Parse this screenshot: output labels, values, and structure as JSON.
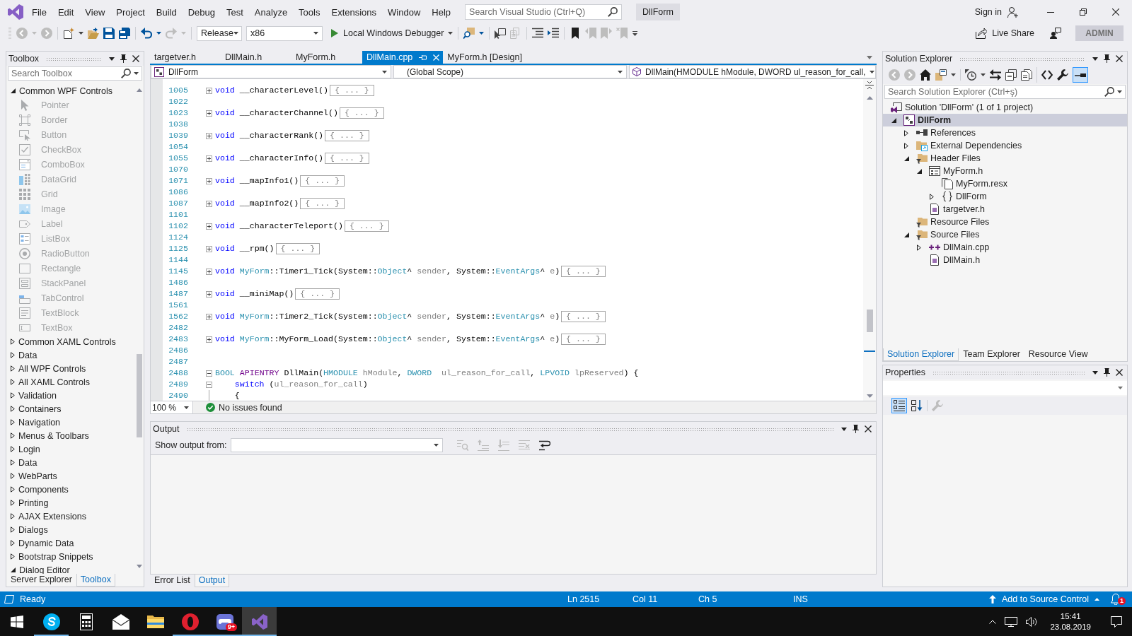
{
  "title_bar": {
    "menu": [
      "File",
      "Edit",
      "View",
      "Project",
      "Build",
      "Debug",
      "Test",
      "Analyze",
      "Tools",
      "Extensions",
      "Window",
      "Help"
    ],
    "search": {
      "placeholder": "Search Visual Studio (Ctrl+Q)"
    },
    "solution_name": "DllForm",
    "sign_in": "Sign in"
  },
  "toolbar": {
    "groups": [
      {
        "items": [
          {
            "kind": "back",
            "disabled": true,
            "dropdown": true
          },
          {
            "kind": "forward",
            "disabled": true,
            "dropdown": false
          }
        ]
      },
      {
        "items": [
          {
            "kind": "new",
            "disabled": false,
            "dropdown": true
          },
          {
            "kind": "open",
            "disabled": false,
            "dropdown": false
          },
          {
            "kind": "save",
            "disabled": false,
            "dropdown": false
          },
          {
            "kind": "saveall",
            "disabled": false,
            "dropdown": false
          }
        ]
      },
      {
        "items": [
          {
            "kind": "undo",
            "disabled": false,
            "dropdown": true
          },
          {
            "kind": "redo",
            "disabled": true,
            "dropdown": true
          }
        ]
      },
      {
        "items": [
          {
            "kind": "configuration",
            "value": "Release"
          },
          {
            "kind": "platform",
            "value": "x86"
          },
          {
            "kind": "run",
            "label": "Local Windows Debugger",
            "dropdown": true
          }
        ]
      },
      {
        "items": [
          {
            "kind": "find",
            "disabled": false,
            "dropdown": true
          }
        ]
      },
      {
        "items": [
          {
            "kind": "select",
            "disabled": false,
            "dropdown": false
          },
          {
            "kind": "pages",
            "disabled": true,
            "dropdown": false
          }
        ]
      },
      {
        "items": [
          {
            "kind": "lines",
            "disabled": false,
            "dropdown": false
          },
          {
            "kind": "listarrow",
            "disabled": false,
            "dropdown": false
          }
        ]
      },
      {
        "items": [
          {
            "kind": "bookmark",
            "disabled": false,
            "dropdown": false
          },
          {
            "kind": "prevbm",
            "disabled": true,
            "dropdown": false
          },
          {
            "kind": "nextbm",
            "disabled": true,
            "dropdown": false
          },
          {
            "kind": "clearbm",
            "disabled": true,
            "dropdown": false
          }
        ]
      }
    ],
    "live_share": "Live Share",
    "account": "ADMIN"
  },
  "toolbox": {
    "title": "Toolbox",
    "search": {
      "placeholder": "Search Toolbox"
    },
    "groups": [
      {
        "label": "Common WPF Controls",
        "expanded": true,
        "items": [
          {
            "label": "Pointer",
            "kind": "pointer",
            "disabled": true
          },
          {
            "label": "Border",
            "kind": "border",
            "disabled": true
          },
          {
            "label": "Button",
            "kind": "button",
            "disabled": true
          },
          {
            "label": "CheckBox",
            "kind": "checkbox",
            "disabled": true
          },
          {
            "label": "ComboBox",
            "kind": "combobox",
            "disabled": true
          },
          {
            "label": "DataGrid",
            "kind": "datagrid",
            "disabled": true
          },
          {
            "label": "Grid",
            "kind": "grid",
            "disabled": true
          },
          {
            "label": "Image",
            "kind": "image",
            "disabled": true
          },
          {
            "label": "Label",
            "kind": "label",
            "disabled": true
          },
          {
            "label": "ListBox",
            "kind": "listbox",
            "disabled": true
          },
          {
            "label": "RadioButton",
            "kind": "radiobutton",
            "disabled": true
          },
          {
            "label": "Rectangle",
            "kind": "rectangle",
            "disabled": true
          },
          {
            "label": "StackPanel",
            "kind": "stackpanel",
            "disabled": true
          },
          {
            "label": "TabControl",
            "kind": "tabcontrol",
            "disabled": true
          },
          {
            "label": "TextBlock",
            "kind": "textblock",
            "disabled": true
          },
          {
            "label": "TextBox",
            "kind": "textbox",
            "disabled": true
          }
        ]
      },
      {
        "label": "Common XAML Controls",
        "expanded": false
      },
      {
        "label": "Data",
        "expanded": false
      },
      {
        "label": "All WPF Controls",
        "expanded": false
      },
      {
        "label": "All XAML Controls",
        "expanded": false
      },
      {
        "label": "Validation",
        "expanded": false
      },
      {
        "label": "Containers",
        "expanded": false
      },
      {
        "label": "Navigation",
        "expanded": false
      },
      {
        "label": "Menus & Toolbars",
        "expanded": false
      },
      {
        "label": "Login",
        "expanded": false
      },
      {
        "label": "Data",
        "expanded": false
      },
      {
        "label": "WebParts",
        "expanded": false
      },
      {
        "label": "Components",
        "expanded": false
      },
      {
        "label": "Printing",
        "expanded": false
      },
      {
        "label": "AJAX Extensions",
        "expanded": false
      },
      {
        "label": "Dialogs",
        "expanded": false
      },
      {
        "label": "Dynamic Data",
        "expanded": false
      },
      {
        "label": "Bootstrap Snippets",
        "expanded": false
      },
      {
        "label": "Dialog Editor",
        "expanded": true
      }
    ],
    "tabs": [
      {
        "label": "Server Explorer",
        "selected": false
      },
      {
        "label": "Toolbox",
        "selected": true
      }
    ]
  },
  "editor": {
    "tabs": [
      {
        "label": "targetver.h",
        "selected": false
      },
      {
        "label": "DllMain.h",
        "selected": false
      },
      {
        "label": "MyForm.h",
        "selected": false
      },
      {
        "label": "DllMain.cpp",
        "selected": true
      },
      {
        "label": "MyForm.h [Design]",
        "selected": false
      }
    ],
    "navigation": {
      "project": "DllForm",
      "scope": "(Global Scope)",
      "member": "DllMain(HMODULE hModule, DWORD ul_reason_for_call,"
    },
    "lines": [
      {
        "number": "1005",
        "expanded": false,
        "tokens": [
          {
            "kind": "keyword",
            "text": "void"
          },
          {
            "kind": "plain",
            "text": " __characterLevel()"
          }
        ],
        "block": "{ ... }"
      },
      {
        "number": "1022"
      },
      {
        "number": "1023",
        "expanded": false,
        "tokens": [
          {
            "kind": "keyword",
            "text": "void"
          },
          {
            "kind": "plain",
            "text": " __characterChannel()"
          }
        ],
        "block": "{ ... }"
      },
      {
        "number": "1038"
      },
      {
        "number": "1039",
        "expanded": false,
        "tokens": [
          {
            "kind": "keyword",
            "text": "void"
          },
          {
            "kind": "plain",
            "text": " __characterRank()"
          }
        ],
        "block": "{ ... }"
      },
      {
        "number": "1054"
      },
      {
        "number": "1055",
        "expanded": false,
        "tokens": [
          {
            "kind": "keyword",
            "text": "void"
          },
          {
            "kind": "plain",
            "text": " __characterInfo()"
          }
        ],
        "block": "{ ... }"
      },
      {
        "number": "1070"
      },
      {
        "number": "1071",
        "expanded": false,
        "tokens": [
          {
            "kind": "keyword",
            "text": "void"
          },
          {
            "kind": "plain",
            "text": " __mapInfo1()"
          }
        ],
        "block": "{ ... }"
      },
      {
        "number": "1086"
      },
      {
        "number": "1087",
        "expanded": false,
        "tokens": [
          {
            "kind": "keyword",
            "text": "void"
          },
          {
            "kind": "plain",
            "text": " __mapInfo2()"
          }
        ],
        "block": "{ ... }"
      },
      {
        "number": "1101"
      },
      {
        "number": "1102",
        "expanded": false,
        "tokens": [
          {
            "kind": "keyword",
            "text": "void"
          },
          {
            "kind": "plain",
            "text": " __characterTeleport()"
          }
        ],
        "block": "{ ... }"
      },
      {
        "number": "1124"
      },
      {
        "number": "1125",
        "expanded": false,
        "tokens": [
          {
            "kind": "keyword",
            "text": "void"
          },
          {
            "kind": "plain",
            "text": " __rpm()"
          }
        ],
        "block": "{ ... }"
      },
      {
        "number": "1144"
      },
      {
        "number": "1145",
        "expanded": false,
        "tokens": [
          {
            "kind": "keyword",
            "text": "void"
          },
          {
            "kind": "type",
            "text": " MyForm"
          },
          {
            "kind": "plain",
            "text": "::Timer1_Tick(System::"
          },
          {
            "kind": "type",
            "text": "Object"
          },
          {
            "kind": "plain",
            "text": "^ "
          },
          {
            "kind": "param",
            "text": "sender"
          },
          {
            "kind": "plain",
            "text": ", System::"
          },
          {
            "kind": "type",
            "text": "EventArgs"
          },
          {
            "kind": "plain",
            "text": "^ "
          },
          {
            "kind": "param",
            "text": "e"
          },
          {
            "kind": "plain",
            "text": ")"
          }
        ],
        "block": "{ ... }"
      },
      {
        "number": "1486"
      },
      {
        "number": "1487",
        "expanded": false,
        "tokens": [
          {
            "kind": "keyword",
            "text": "void"
          },
          {
            "kind": "plain",
            "text": " __miniMap()"
          }
        ],
        "block": "{ ... }"
      },
      {
        "number": "1561"
      },
      {
        "number": "1562",
        "expanded": false,
        "tokens": [
          {
            "kind": "keyword",
            "text": "void"
          },
          {
            "kind": "type",
            "text": " MyForm"
          },
          {
            "kind": "plain",
            "text": "::Timer2_Tick(System::"
          },
          {
            "kind": "type",
            "text": "Object"
          },
          {
            "kind": "plain",
            "text": "^ "
          },
          {
            "kind": "param",
            "text": "sender"
          },
          {
            "kind": "plain",
            "text": ", System::"
          },
          {
            "kind": "type",
            "text": "EventArgs"
          },
          {
            "kind": "plain",
            "text": "^ "
          },
          {
            "kind": "param",
            "text": "e"
          },
          {
            "kind": "plain",
            "text": ")"
          }
        ],
        "block": "{ ... }"
      },
      {
        "number": "2482"
      },
      {
        "number": "2483",
        "expanded": false,
        "tokens": [
          {
            "kind": "keyword",
            "text": "void"
          },
          {
            "kind": "type",
            "text": " MyForm"
          },
          {
            "kind": "plain",
            "text": "::MyForm_Load(System::"
          },
          {
            "kind": "type",
            "text": "Object"
          },
          {
            "kind": "plain",
            "text": "^ "
          },
          {
            "kind": "param",
            "text": "sender"
          },
          {
            "kind": "plain",
            "text": ", System::"
          },
          {
            "kind": "type",
            "text": "EventArgs"
          },
          {
            "kind": "plain",
            "text": "^ "
          },
          {
            "kind": "param",
            "text": "e"
          },
          {
            "kind": "plain",
            "text": ")"
          }
        ],
        "block": "{ ... }"
      },
      {
        "number": "2486"
      },
      {
        "number": "2487"
      },
      {
        "number": "2488",
        "expanded": true,
        "tokens": [
          {
            "kind": "type",
            "text": "BOOL"
          },
          {
            "kind": "macro",
            "text": " APIENTRY"
          },
          {
            "kind": "plain",
            "text": " DllMain("
          },
          {
            "kind": "type",
            "text": "HMODULE"
          },
          {
            "kind": "param",
            "text": " hModule"
          },
          {
            "kind": "plain",
            "text": ", "
          },
          {
            "kind": "type",
            "text": "DWORD"
          },
          {
            "kind": "param",
            "text": "  ul_reason_for_call"
          },
          {
            "kind": "plain",
            "text": ", "
          },
          {
            "kind": "type",
            "text": "LPVOID"
          },
          {
            "kind": "param",
            "text": " lpReserved"
          },
          {
            "kind": "plain",
            "text": ") {"
          }
        ]
      },
      {
        "number": "2489",
        "expanded": true,
        "tokens": [
          {
            "kind": "keyword",
            "text": "    switch"
          },
          {
            "kind": "plain",
            "text": " ("
          },
          {
            "kind": "param",
            "text": "ul_reason_for_call"
          },
          {
            "kind": "plain",
            "text": ")"
          }
        ]
      },
      {
        "number": "2490",
        "guide": true,
        "tokens": [
          {
            "kind": "plain",
            "text": "    {"
          }
        ]
      }
    ],
    "zoom": "100 %",
    "issues": "No issues found"
  },
  "output": {
    "title": "Output",
    "source_label": "Show output from:",
    "toolbar": [
      {
        "kind": "findmsg",
        "disabled": true
      },
      {
        "kind": "prevmsg",
        "disabled": true
      },
      {
        "kind": "nextmsg",
        "disabled": true
      },
      {
        "kind": "clearall",
        "disabled": true
      },
      {
        "kind": "wordwrap",
        "disabled": false
      }
    ],
    "tabs": [
      {
        "label": "Error List",
        "selected": false
      },
      {
        "label": "Output",
        "selected": true
      }
    ]
  },
  "solution_explorer": {
    "title": "Solution Explorer",
    "toolbar": {
      "groups": [
        {
          "items": [
            {
              "kind": "back",
              "disabled": true,
              "selected": false
            },
            {
              "kind": "forward",
              "disabled": true,
              "selected": false
            },
            {
              "kind": "home",
              "disabled": false,
              "selected": false
            },
            {
              "kind": "switchviews",
              "disabled": false,
              "selected": false,
              "dropdown": true
            }
          ]
        },
        {
          "items": [
            {
              "kind": "history",
              "disabled": false,
              "selected": false,
              "dropdown": true
            },
            {
              "kind": "sync",
              "disabled": false,
              "selected": false
            },
            {
              "kind": "collapse",
              "disabled": false,
              "selected": false
            },
            {
              "kind": "showall",
              "disabled": false,
              "selected": false
            }
          ]
        },
        {
          "items": [
            {
              "kind": "code",
              "disabled": false,
              "selected": false
            },
            {
              "kind": "wrench",
              "disabled": false,
              "selected": false
            },
            {
              "kind": "preview",
              "disabled": false,
              "selected": true
            }
          ]
        }
      ]
    },
    "search": {
      "placeholder": "Search Solution Explorer (Ctrl+ş)"
    },
    "tree": [
      {
        "label": "Solution 'DllForm' (1 of 1 project)",
        "kind": "solution",
        "selected": false,
        "children": [
          {
            "label": "DllForm",
            "kind": "project",
            "selected": true,
            "expanded": true,
            "children": [
              {
                "label": "References",
                "kind": "references",
                "selected": false,
                "expanded": false
              },
              {
                "label": "External Dependencies",
                "kind": "dependencies",
                "selected": false,
                "expanded": false
              },
              {
                "label": "Header Files",
                "kind": "filter",
                "selected": false,
                "expanded": true,
                "children": [
                  {
                    "label": "MyForm.h",
                    "kind": "form",
                    "selected": false,
                    "expanded": true,
                    "children": [
                      {
                        "label": "MyForm.resx",
                        "kind": "resource",
                        "selected": false
                      },
                      {
                        "label": "DllForm",
                        "kind": "namespace",
                        "selected": false,
                        "expanded": false
                      }
                    ]
                  },
                  {
                    "label": "targetver.h",
                    "kind": "header",
                    "selected": false
                  }
                ]
              },
              {
                "label": "Resource Files",
                "kind": "filter",
                "selected": false
              },
              {
                "label": "Source Files",
                "kind": "filter",
                "selected": false,
                "expanded": true,
                "children": [
                  {
                    "label": "DllMain.cpp",
                    "kind": "source",
                    "selected": false,
                    "expanded": false
                  },
                  {
                    "label": "DllMain.h",
                    "kind": "header",
                    "selected": false
                  }
                ]
              }
            ]
          }
        ]
      }
    ],
    "tabs": [
      {
        "label": "Solution Explorer",
        "selected": true
      },
      {
        "label": "Team Explorer",
        "selected": false
      },
      {
        "label": "Resource View",
        "selected": false
      }
    ]
  },
  "properties": {
    "title": "Properties",
    "toolbar": {
      "groups": [
        {
          "items": [
            {
              "kind": "categorized",
              "disabled": false,
              "selected": true
            },
            {
              "kind": "alphabetical",
              "disabled": false,
              "selected": false
            }
          ]
        },
        {
          "items": [
            {
              "kind": "propertypages",
              "disabled": true,
              "selected": false
            }
          ]
        }
      ]
    }
  },
  "status_bar": {
    "state": "Ready",
    "line": "Ln 2515",
    "column": "Col 11",
    "char": "Ch 5",
    "mode": "INS",
    "source_control": "Add to Source Control",
    "notifications": "1"
  },
  "taskbar": {
    "apps": [
      {
        "kind": "chat",
        "running": true,
        "selected": false
      },
      {
        "kind": "calculator",
        "running": false,
        "selected": false
      },
      {
        "kind": "mail",
        "running": false,
        "selected": false
      },
      {
        "kind": "folder",
        "running": false,
        "selected": false
      },
      {
        "kind": "browser",
        "running": true,
        "selected": false
      },
      {
        "kind": "messenger",
        "running": true,
        "selected": false,
        "badge": "9+"
      },
      {
        "kind": "ide",
        "running": true,
        "selected": true
      }
    ],
    "time": "15:41",
    "date": "23.08.2019"
  }
}
